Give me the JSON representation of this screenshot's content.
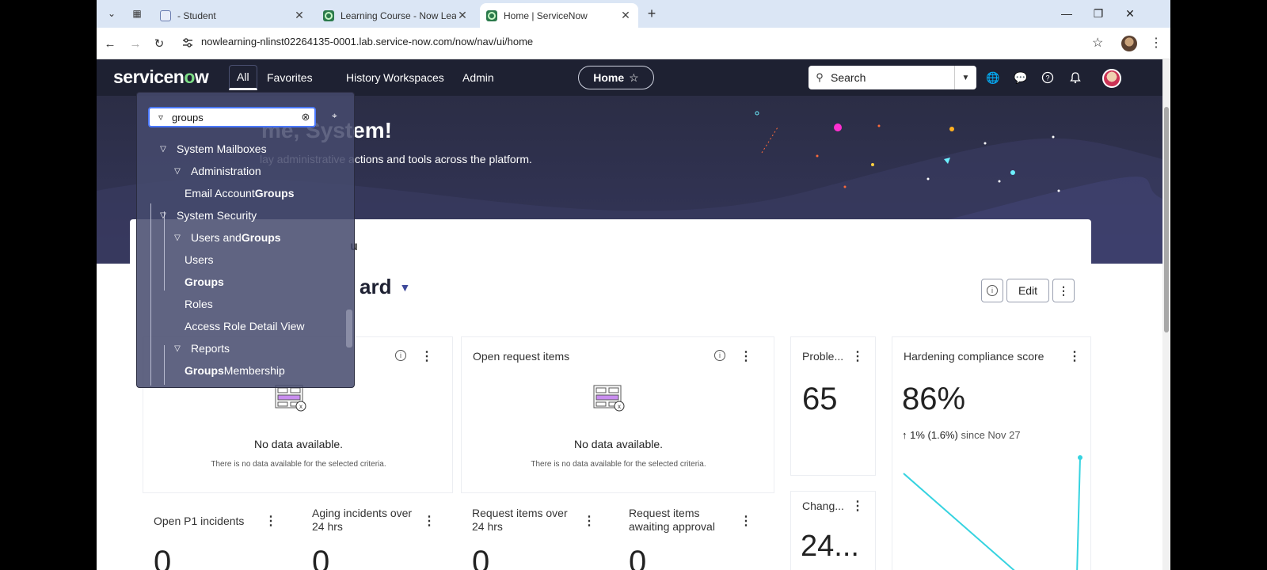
{
  "browser": {
    "tabs": [
      {
        "title": "- Student",
        "active": false
      },
      {
        "title": "Learning Course - Now Learnin",
        "active": false
      },
      {
        "title": "Home | ServiceNow",
        "active": true
      }
    ],
    "new_tab_glyph": "+",
    "url": "nowlearning-nlinst02264135-0001.lab.service-now.com/now/nav/ui/home",
    "icons": [
      "back-icon",
      "forward-icon",
      "reload-icon",
      "site-info-icon",
      "bookmark-star-icon",
      "profile-icon",
      "menu-kebab-icon",
      "minimize-icon",
      "restore-icon",
      "close-icon"
    ]
  },
  "header": {
    "logo": {
      "prefix": "servicen",
      "o": "o",
      "suffix": "w"
    },
    "nav": [
      "All",
      "Favorites",
      "History",
      "Workspaces",
      "Admin"
    ],
    "home_pill": "Home",
    "search_label": "Search"
  },
  "hero": {
    "title_visible": "me, System!",
    "subtitle_visible": "lay administrative actions and tools across the platform."
  },
  "dashboard": {
    "section_title_visible": "u",
    "title_visible": "ard",
    "edit_label": "Edit"
  },
  "widgets": {
    "w1": {
      "nodata": "No data available.",
      "nodata_sub": "There is no data available for the selected criteria."
    },
    "open_requests": {
      "title": "Open request items",
      "nodata": "No data available.",
      "nodata_sub": "There is no data available for the selected criteria."
    },
    "problems": {
      "title": "Proble...",
      "value": "65"
    },
    "hardening": {
      "title": "Hardening compliance score",
      "value": "86%",
      "delta": "1% (1.6%)",
      "since": "since Nov 27"
    },
    "changes": {
      "title": "Chang...",
      "value": "24..."
    },
    "open_p1": {
      "title": "Open P1 incidents",
      "value": "0"
    },
    "aging": {
      "title_l1": "Aging incidents over",
      "title_l2": "24 hrs",
      "value": "0"
    },
    "req_over": {
      "title_l1": "Request items over",
      "title_l2": "24 hrs",
      "value": "0"
    },
    "req_await": {
      "title_l1": "Request items",
      "title_l2": "awaiting approval",
      "value": "0"
    }
  },
  "all_menu": {
    "filter_value": "groups",
    "tree": [
      {
        "pre": "System Mailboxes",
        "hl": "",
        "post": ""
      },
      {
        "pre": "Administration",
        "hl": "",
        "post": ""
      },
      {
        "pre": "Email Account ",
        "hl": "Groups",
        "post": ""
      },
      {
        "pre": "System Security",
        "hl": "",
        "post": ""
      },
      {
        "pre": "Users and ",
        "hl": "Groups",
        "post": ""
      },
      {
        "pre": "Users",
        "hl": "",
        "post": ""
      },
      {
        "pre": "",
        "hl": "Groups",
        "post": ""
      },
      {
        "pre": "Roles",
        "hl": "",
        "post": ""
      },
      {
        "pre": "Access Role Detail View",
        "hl": "",
        "post": ""
      },
      {
        "pre": "Reports",
        "hl": "",
        "post": ""
      },
      {
        "pre": "",
        "hl": "Groups",
        "post": " Membership"
      }
    ]
  },
  "colors": {
    "header_bg": "#1e2132",
    "accent_green": "#7dde86",
    "chart_line": "#36d3e0",
    "filter_focus": "#4a78ff"
  }
}
